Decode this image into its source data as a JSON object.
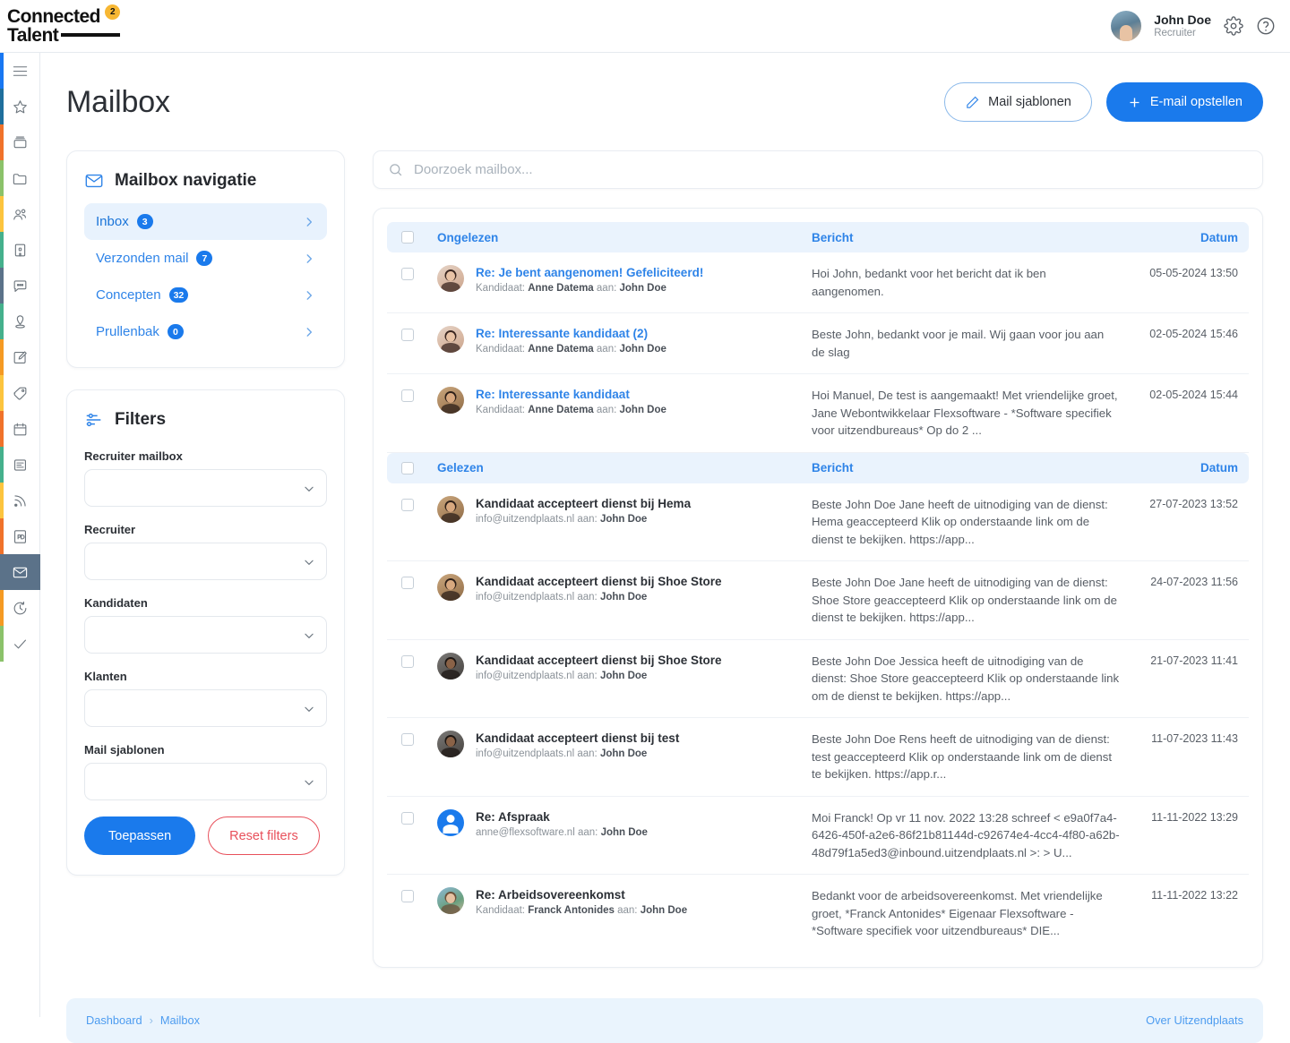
{
  "brand": {
    "line1": "Connected",
    "line2": "Talent",
    "superscript": "2"
  },
  "header": {
    "user_name": "John Doe",
    "user_role": "Recruiter",
    "settings_icon": "gear-icon",
    "help_icon": "question-circle-icon"
  },
  "rail": {
    "items": [
      {
        "icon": "hamburger-menu-icon",
        "color": "#1877f2"
      },
      {
        "icon": "star-icon",
        "color": "#1f6f9c"
      },
      {
        "icon": "archive-box-icon",
        "color": "#f0722a"
      },
      {
        "icon": "folder-icon",
        "color": "#8bc26a"
      },
      {
        "icon": "users-icon",
        "color": "#fcc43e"
      },
      {
        "icon": "building-icon",
        "color": "#45b08c"
      },
      {
        "icon": "chat-bubble-icon",
        "color": "#5b7289"
      },
      {
        "icon": "location-pin-icon",
        "color": "#45b08c"
      },
      {
        "icon": "edit-note-icon",
        "color": "#f59a23"
      },
      {
        "icon": "tag-icon",
        "color": "#fcc43e"
      },
      {
        "icon": "calendar-icon",
        "color": "#f0722a"
      },
      {
        "icon": "document-icon",
        "color": "#45b08c"
      },
      {
        "icon": "rss-feed-icon",
        "color": "#fcc43e"
      },
      {
        "icon": "pdf-file-icon",
        "color": "#f0722a"
      },
      {
        "icon": "envelope-icon",
        "color": "#5b7289",
        "active": true
      },
      {
        "icon": "clock-history-icon",
        "color": "#f59a23"
      },
      {
        "icon": "check-icon",
        "color": "#8bc26a"
      }
    ]
  },
  "page": {
    "title": "Mailbox",
    "templates_button": "Mail sjablonen",
    "compose_button": "E-mail opstellen"
  },
  "mailbox_nav": {
    "title": "Mailbox navigatie",
    "items": [
      {
        "label": "Inbox",
        "count": "3",
        "active": true
      },
      {
        "label": "Verzonden mail",
        "count": "7",
        "active": false
      },
      {
        "label": "Concepten",
        "count": "32",
        "active": false
      },
      {
        "label": "Prullenbak",
        "count": "0",
        "active": false
      }
    ]
  },
  "filters": {
    "title": "Filters",
    "fields": [
      {
        "label": "Recruiter mailbox",
        "value": ""
      },
      {
        "label": "Recruiter",
        "value": ""
      },
      {
        "label": "Kandidaten",
        "value": ""
      },
      {
        "label": "Klanten",
        "value": ""
      },
      {
        "label": "Mail sjablonen",
        "value": ""
      }
    ],
    "apply_label": "Toepassen",
    "reset_label": "Reset filters"
  },
  "search": {
    "placeholder": "Doorzoek mailbox...",
    "value": ""
  },
  "list": {
    "groups": [
      {
        "header": {
          "status": "Ongelezen",
          "message": "Bericht",
          "date": "Datum"
        },
        "rows": [
          {
            "subject": "Re: Je bent aangenomen! Gefeliciteerd!",
            "meta_prefix": "Kandidaat:",
            "meta_from": "Anne Datema",
            "meta_to_label": "aan:",
            "meta_to": "John Doe",
            "snippet": "Hoi John, bedankt voor het bericht dat ik ben aangenomen.",
            "date": "05-05-2024 13:50",
            "unread": true,
            "avatar": "woman-dark-hair-avatar"
          },
          {
            "subject": "Re: Interessante kandidaat (2)",
            "meta_prefix": "Kandidaat:",
            "meta_from": "Anne Datema",
            "meta_to_label": "aan:",
            "meta_to": "John Doe",
            "snippet": "Beste John, bedankt voor je mail. Wij gaan voor jou aan de slag",
            "date": "02-05-2024 15:46",
            "unread": true,
            "avatar": "woman-dark-hair-avatar"
          },
          {
            "subject": "Re: Interessante kandidaat",
            "meta_prefix": "Kandidaat:",
            "meta_from": "Anne Datema",
            "meta_to_label": "aan:",
            "meta_to": "John Doe",
            "snippet": "Hoi Manuel, De test is aangemaakt! Met vriendelijke groet, Jane Webontwikkelaar Flexsoftware - *Software specifiek voor uitzendbureaus* Op do 2 ...",
            "date": "02-05-2024 15:44",
            "unread": true,
            "avatar": "man-glasses-avatar"
          }
        ]
      },
      {
        "header": {
          "status": "Gelezen",
          "message": "Bericht",
          "date": "Datum"
        },
        "rows": [
          {
            "subject": "Kandidaat accepteert dienst bij Hema",
            "meta_prefix": "info@uitzendplaats.nl",
            "meta_from": "",
            "meta_to_label": "aan:",
            "meta_to": "John Doe",
            "snippet": "Beste John Doe Jane heeft de uitnodiging van de dienst: Hema geaccepteerd Klik op onderstaande link om de dienst te bekijken. https://app...",
            "date": "27-07-2023 13:52",
            "unread": false,
            "avatar": "man-glasses-avatar"
          },
          {
            "subject": "Kandidaat accepteert dienst bij Shoe Store",
            "meta_prefix": "info@uitzendplaats.nl",
            "meta_from": "",
            "meta_to_label": "aan:",
            "meta_to": "John Doe",
            "snippet": "Beste John Doe Jane heeft de uitnodiging van de dienst: Shoe Store geaccepteerd Klik op onderstaande link om de dienst te bekijken. https://app...",
            "date": "24-07-2023 11:56",
            "unread": false,
            "avatar": "man-glasses-avatar"
          },
          {
            "subject": "Kandidaat accepteert dienst bij Shoe Store",
            "meta_prefix": "info@uitzendplaats.nl",
            "meta_from": "",
            "meta_to_label": "aan:",
            "meta_to": "John Doe",
            "snippet": "Beste John Doe Jessica heeft de uitnodiging van de dienst: Shoe Store geaccepteerd Klik op onderstaande link om de dienst te bekijken. https://app...",
            "date": "21-07-2023 11:41",
            "unread": false,
            "avatar": "man-dark-avatar"
          },
          {
            "subject": "Kandidaat accepteert dienst bij test",
            "meta_prefix": "info@uitzendplaats.nl",
            "meta_from": "",
            "meta_to_label": "aan:",
            "meta_to": "John Doe",
            "snippet": "Beste John Doe Rens heeft de uitnodiging van de dienst: test geaccepteerd Klik op onderstaande link om de dienst te bekijken. https://app.r...",
            "date": "11-07-2023 11:43",
            "unread": false,
            "avatar": "man-dark-avatar"
          },
          {
            "subject": "Re: Afspraak",
            "meta_prefix": "anne@flexsoftware.nl",
            "meta_from": "",
            "meta_to_label": "aan:",
            "meta_to": "John Doe",
            "snippet": "Moi Franck! Op vr 11 nov. 2022 13:28 schreef < e9a0f7a4-6426-450f-a2e6-86f21b81144d-c92674e4-4cc4-4f80-a62b-48d79f1a5ed3@inbound.uitzendplaats.nl >: > U...",
            "date": "11-11-2022 13:29",
            "unread": false,
            "avatar": "default-person-avatar"
          },
          {
            "subject": "Re: Arbeidsovereenkomst",
            "meta_prefix": "Kandidaat:",
            "meta_from": "Franck Antonides",
            "meta_to_label": "aan:",
            "meta_to": "John Doe",
            "snippet": "Bedankt voor de arbeidsovereenkomst. Met vriendelijke groet, *Franck Antonides* Eigenaar Flexsoftware - *Software specifiek voor uitzendbureaus* DIE...",
            "date": "11-11-2022 13:22",
            "unread": false,
            "avatar": "man-outdoor-avatar"
          }
        ]
      }
    ]
  },
  "footer": {
    "breadcrumb_home": "Dashboard",
    "breadcrumb_sep": "›",
    "breadcrumb_current": "Mailbox",
    "right_link": "Over Uitzendplaats"
  },
  "colors": {
    "primary": "#1a7aec",
    "link": "#2f84e8",
    "danger": "#e8505b",
    "active_rail": "#5b7289",
    "group_header_bg": "#eaf3fd"
  }
}
